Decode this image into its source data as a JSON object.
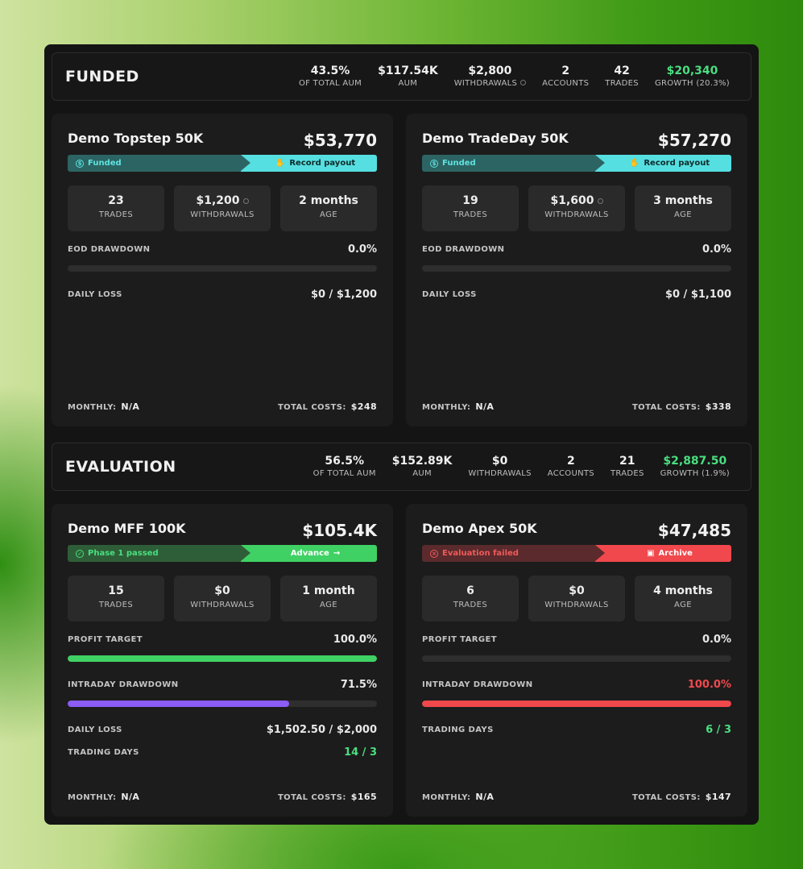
{
  "funded": {
    "title": "FUNDED",
    "stats": [
      {
        "value": "43.5%",
        "label": "OF TOTAL AUM"
      },
      {
        "value": "$117.54K",
        "label": "AUM"
      },
      {
        "value": "$2,800",
        "label": "WITHDRAWALS"
      },
      {
        "value": "2",
        "label": "ACCOUNTS"
      },
      {
        "value": "42",
        "label": "TRADES"
      },
      {
        "value": "$20,340",
        "label": "GROWTH (20.3%)"
      }
    ],
    "cards": [
      {
        "name": "Demo Topstep 50K",
        "balance": "$53,770",
        "status_left": "Funded",
        "status_right": "Record payout",
        "trades": "23",
        "trades_label": "TRADES",
        "withdrawals": "$1,200",
        "withdrawals_label": "WITHDRAWALS",
        "age": "2 months",
        "age_label": "AGE",
        "drawdown_label": "EOD DRAWDOWN",
        "drawdown_value": "0.0%",
        "drawdown_fill": 0,
        "daily_loss_label": "DAILY LOSS",
        "daily_loss_value": "$0 / $1,200",
        "monthly_label": "MONTHLY:",
        "monthly_value": "N/A",
        "costs_label": "TOTAL COSTS:",
        "costs_value": "$248"
      },
      {
        "name": "Demo TradeDay 50K",
        "balance": "$57,270",
        "status_left": "Funded",
        "status_right": "Record payout",
        "trades": "19",
        "trades_label": "TRADES",
        "withdrawals": "$1,600",
        "withdrawals_label": "WITHDRAWALS",
        "age": "3 months",
        "age_label": "AGE",
        "drawdown_label": "EOD DRAWDOWN",
        "drawdown_value": "0.0%",
        "drawdown_fill": 0,
        "daily_loss_label": "DAILY LOSS",
        "daily_loss_value": "$0 / $1,100",
        "monthly_label": "MONTHLY:",
        "monthly_value": "N/A",
        "costs_label": "TOTAL COSTS:",
        "costs_value": "$338"
      }
    ]
  },
  "evaluation": {
    "title": "EVALUATION",
    "stats": [
      {
        "value": "56.5%",
        "label": "OF TOTAL AUM"
      },
      {
        "value": "$152.89K",
        "label": "AUM"
      },
      {
        "value": "$0",
        "label": "WITHDRAWALS"
      },
      {
        "value": "2",
        "label": "ACCOUNTS"
      },
      {
        "value": "21",
        "label": "TRADES"
      },
      {
        "value": "$2,887.50",
        "label": "GROWTH (1.9%)"
      }
    ],
    "cards": [
      {
        "name": "Demo MFF 100K",
        "balance": "$105.4K",
        "status_left": "Phase 1 passed",
        "status_right": "Advance",
        "trades": "15",
        "trades_label": "TRADES",
        "withdrawals": "$0",
        "withdrawals_label": "WITHDRAWALS",
        "age": "1 month",
        "age_label": "AGE",
        "target_label": "PROFIT TARGET",
        "target_value": "100.0%",
        "target_fill": 1.0,
        "drawdown_label": "INTRADAY DRAWDOWN",
        "drawdown_value": "71.5%",
        "drawdown_fill": 0.715,
        "daily_loss_label": "DAILY LOSS",
        "daily_loss_value": "$1,502.50 / $2,000",
        "days_label": "TRADING DAYS",
        "days_value": "14 / 3",
        "monthly_label": "MONTHLY:",
        "monthly_value": "N/A",
        "costs_label": "TOTAL COSTS:",
        "costs_value": "$165"
      },
      {
        "name": "Demo Apex 50K",
        "balance": "$47,485",
        "status_left": "Evaluation failed",
        "status_right": "Archive",
        "trades": "6",
        "trades_label": "TRADES",
        "withdrawals": "$0",
        "withdrawals_label": "WITHDRAWALS",
        "age": "4 months",
        "age_label": "AGE",
        "target_label": "PROFIT TARGET",
        "target_value": "0.0%",
        "target_fill": 0,
        "drawdown_label": "INTRADAY DRAWDOWN",
        "drawdown_value": "100.0%",
        "drawdown_fill": 1.0,
        "days_label": "TRADING DAYS",
        "days_value": "6 / 3",
        "monthly_label": "MONTHLY:",
        "monthly_value": "N/A",
        "costs_label": "TOTAL COSTS:",
        "costs_value": "$147"
      }
    ]
  },
  "colors": {
    "accent_cyan": "#56dfe0",
    "accent_green": "#3fd164",
    "accent_red": "#f0484c",
    "accent_purple": "#8b5cf6"
  },
  "icons": {
    "funded": "dollar-circle-icon",
    "payout": "hand-coins-icon",
    "passed": "check-circle-icon",
    "advance": "arrow-right-icon",
    "failed": "x-circle-icon",
    "archive": "archive-box-icon",
    "info": "info-icon"
  }
}
